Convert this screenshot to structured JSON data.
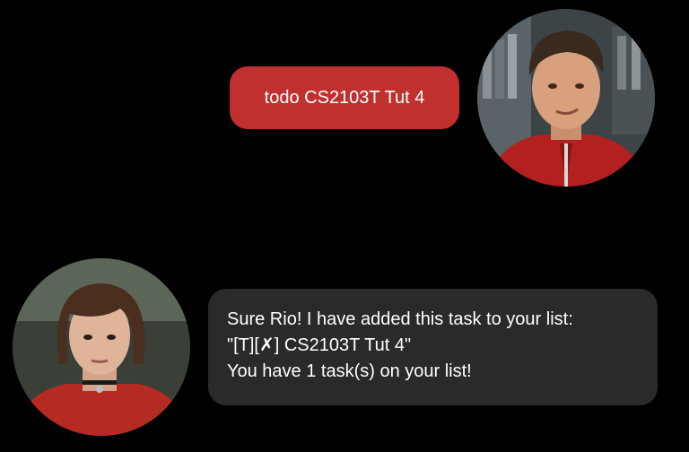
{
  "conversation": {
    "user_message": "todo CS2103T Tut 4",
    "bot_reply_lines": [
      "Sure Rio! I have added this task to your list:",
      "\"[T][✗] CS2103T Tut 4\"",
      "You have 1 task(s) on your list!"
    ]
  },
  "avatars": {
    "user": "user-avatar-photo",
    "bot": "bot-avatar-photo"
  },
  "colors": {
    "background": "#000000",
    "user_bubble": "#c0302f",
    "bot_bubble": "#2a2a2c",
    "text": "#ffffff"
  }
}
